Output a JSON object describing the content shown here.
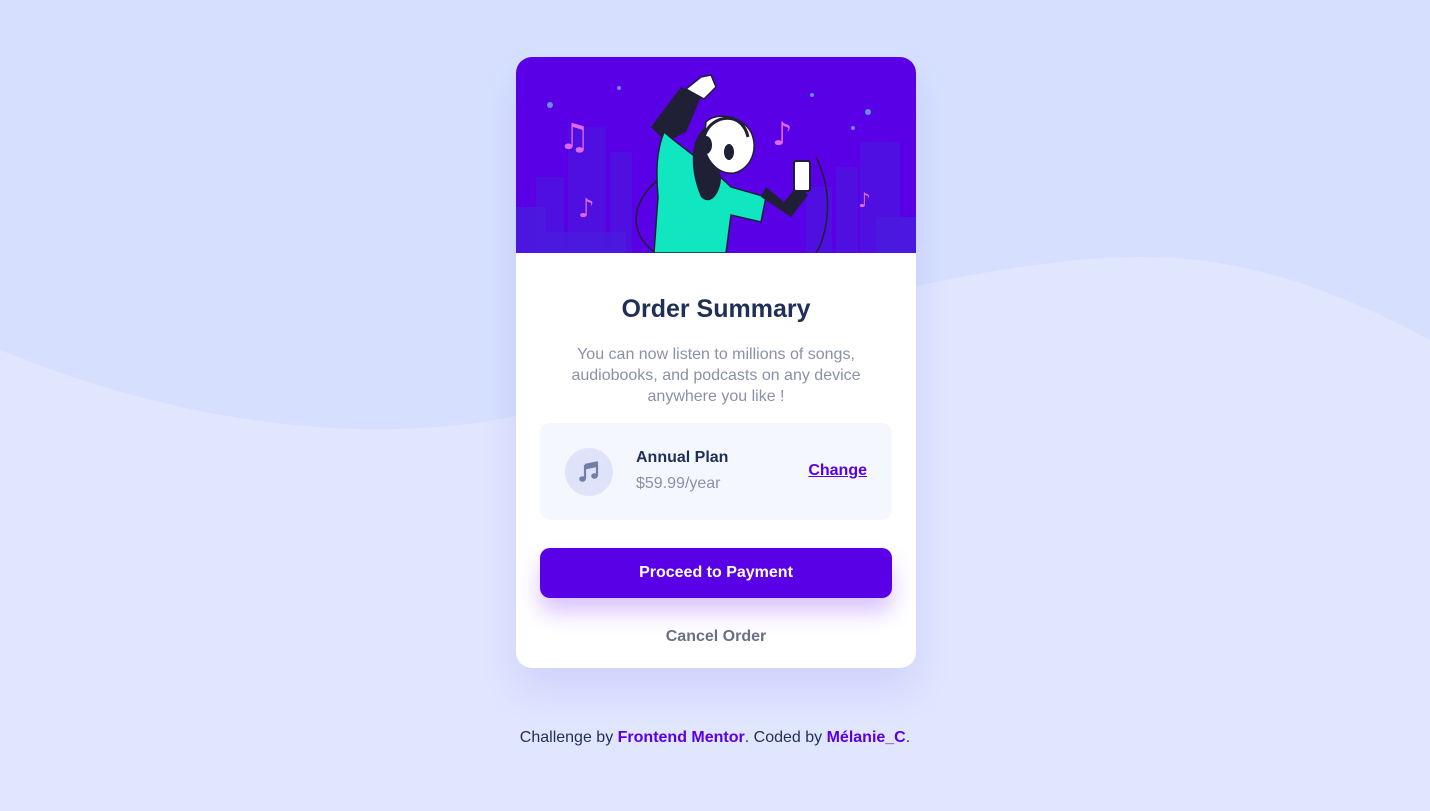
{
  "order": {
    "title": "Order Summary",
    "description": "You can now listen to millions of songs, audiobooks, and podcasts on any device anywhere you like !",
    "plan": {
      "icon": "music-note-icon",
      "name": "Annual Plan",
      "price": "$59.99/year",
      "change_label": "Change"
    },
    "proceed_label": "Proceed to Payment",
    "cancel_label": "Cancel Order"
  },
  "hero": {
    "illustration": "woman-dancing-with-headphones"
  },
  "footer": {
    "prefix": "Challenge by",
    "link1": "Frontend Mentor",
    "middle": ". Coded by",
    "link2": "Mélanie_C",
    "suffix": "."
  },
  "colors": {
    "background": "#e0e6fe",
    "wave": "#d6e0fe",
    "accent": "#5a00e6",
    "dark_text": "#1f2f56",
    "muted_text": "#8b90a8",
    "hero_bg": "#5a00e6"
  }
}
